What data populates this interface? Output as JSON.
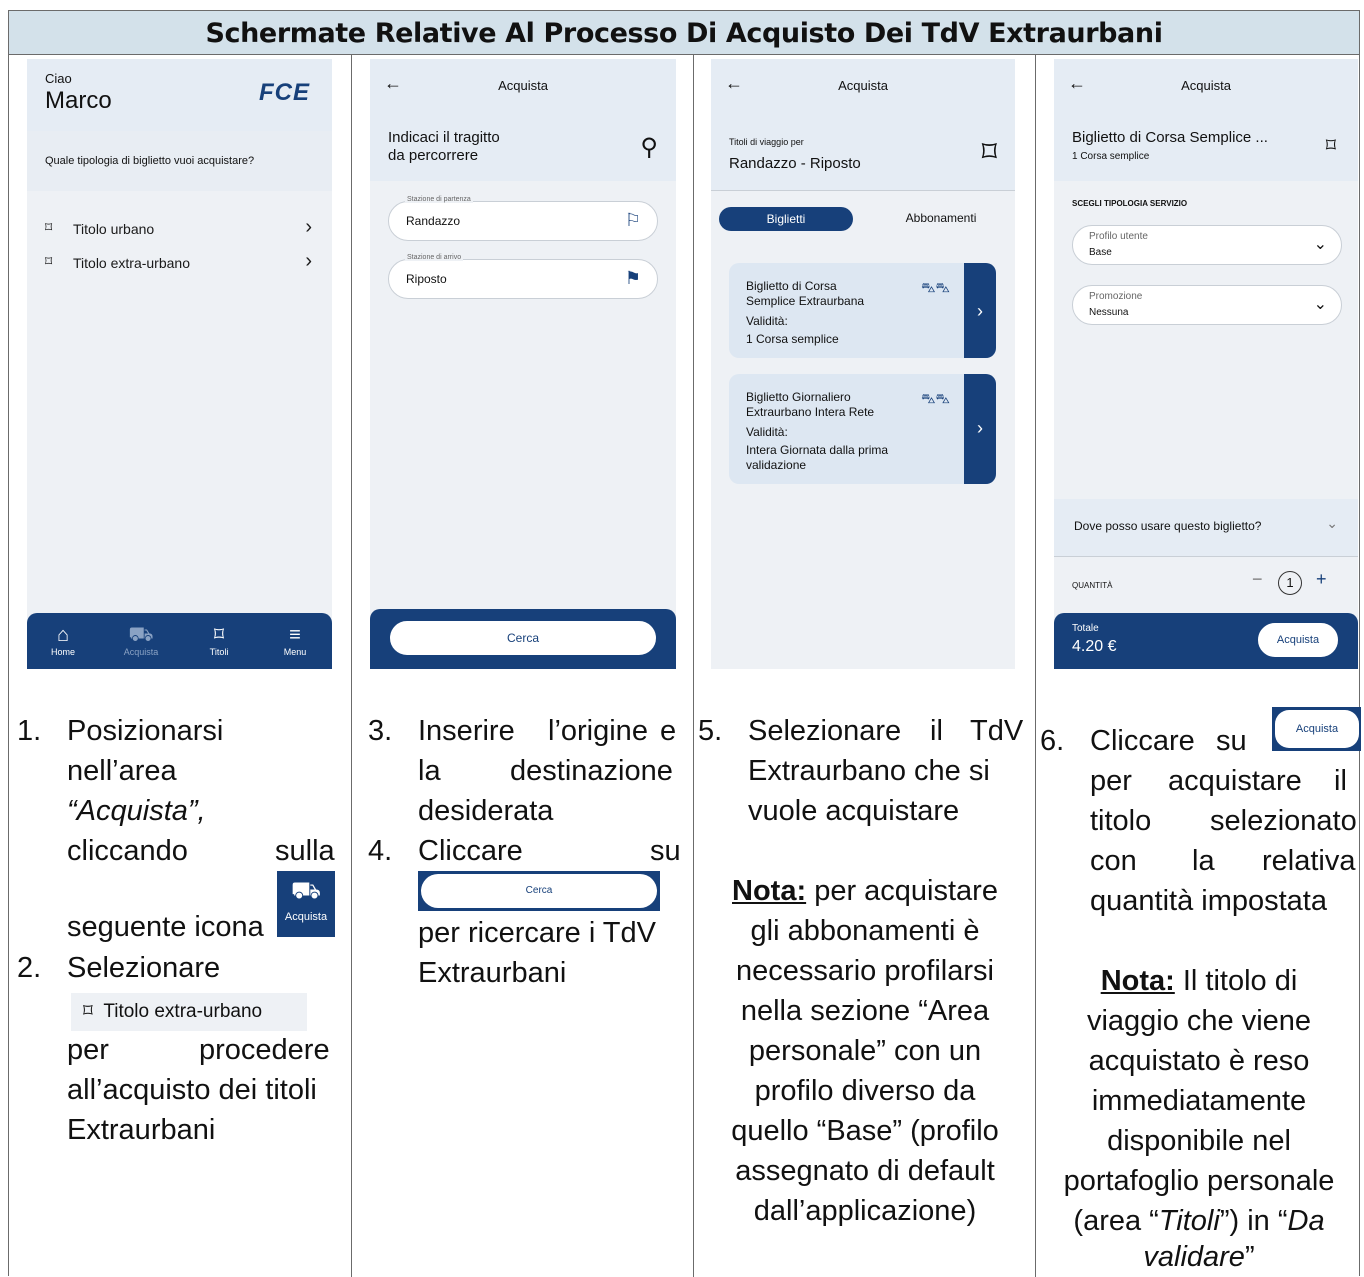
{
  "header": {
    "title": "Schermate Relative Al Processo Di Acquisto Dei TdV Extraurbani"
  },
  "screen1": {
    "greeting": "Ciao",
    "name": "Marco",
    "logo": "FCE",
    "question": "Quale tipologia di biglietto vuoi acquistare?",
    "items": [
      {
        "label": "Titolo urbano"
      },
      {
        "label": "Titolo extra-urbano"
      }
    ],
    "nav": [
      {
        "label": "Home"
      },
      {
        "label": "Acquista"
      },
      {
        "label": "Titoli"
      },
      {
        "label": "Menu"
      }
    ]
  },
  "screen2": {
    "title": "Acquista",
    "prompt_line1": "Indicaci il tragitto",
    "prompt_line2": "da percorrere",
    "dep_label": "Stazione di partenza",
    "dep_value": "Randazzo",
    "arr_label": "Stazione di arrivo",
    "arr_value": "Riposto",
    "search_button": "Cerca"
  },
  "screen3": {
    "title": "Acquista",
    "subtitle": "Titoli di viaggio per",
    "route": "Randazzo - Riposto",
    "tab_active": "Biglietti",
    "tab_inactive": "Abbonamenti",
    "cards": [
      {
        "title_l1": "Biglietto di Corsa",
        "title_l2": "Semplice Extraurbana",
        "validity_label": "Validità:",
        "validity_l1": "1 Corsa semplice",
        "validity_l2": ""
      },
      {
        "title_l1": "Biglietto Giornaliero",
        "title_l2": "Extraurbano Intera Rete",
        "validity_label": "Validità:",
        "validity_l1": "Intera Giornata dalla prima",
        "validity_l2": "validazione"
      }
    ]
  },
  "screen4": {
    "title": "Acquista",
    "ticket_title": "Biglietto di Corsa Semplice ...",
    "ticket_sub": "1 Corsa semplice",
    "section": "SCEGLI TIPOLOGIA SERVIZIO",
    "profile_label": "Profilo utente",
    "profile_value": "Base",
    "promo_label": "Promozione",
    "promo_value": "Nessuna",
    "faq": "Dove posso usare questo biglietto?",
    "qty_label": "QUANTITÀ",
    "qty_value": "1",
    "total_label": "Totale",
    "total_value": "4.20 €",
    "buy_button": "Acquista"
  },
  "instructions": {
    "s1_num": "1.",
    "s1_l1": "Posizionarsi",
    "s1_l2": "nell’area",
    "s1_l3": "“Acquista”,",
    "s1_l4a": "cliccando",
    "s1_l4b": "sulla",
    "s1_l5": "seguente icona",
    "s1_icon_label": "Acquista",
    "s2_num": "2.",
    "s2_l1": "Selezionare",
    "s2_chip": "Titolo extra-urbano",
    "s2_l2a": "per",
    "s2_l2b": "procedere",
    "s2_l3": "all’acquisto dei titoli",
    "s2_l4": "Extraurbani",
    "s3_num": "3.",
    "s3_l1a": "Inserire",
    "s3_l1b": "l’origine",
    "s3_l1c": "e",
    "s3_l2a": "la",
    "s3_l2b": "destinazione",
    "s3_l3": "desiderata",
    "s4_num": "4.",
    "s4_l1a": "Cliccare",
    "s4_l1b": "su",
    "s4_btn": "Cerca",
    "s4_l2": "per ricercare i TdV",
    "s4_l3": "Extraurbani",
    "s5_num": "5.",
    "s5_l1a": "Selezionare",
    "s5_l1b": "il",
    "s5_l1c": "TdV",
    "s5_l2": "Extraurbano che si",
    "s5_l3": "vuole acquistare",
    "n5_label": "Nota:",
    "n5_l1": "per acquistare",
    "n5_l2": "gli abbonamenti è",
    "n5_l3": "necessario profilarsi",
    "n5_l4": "nella sezione “Area",
    "n5_l5": "personale” con un",
    "n5_l6": "profilo diverso da",
    "n5_l7": "quello “Base” (profilo",
    "n5_l8": "assegnato di default",
    "n5_l9": "dall’applicazione)",
    "s6_num": "6.",
    "s6_l1a": "Cliccare",
    "s6_l1b": "su",
    "s6_btn": "Acquista",
    "s6_l2a": "per",
    "s6_l2b": "acquistare",
    "s6_l2c": "il",
    "s6_l3a": "titolo",
    "s6_l3b": "selezionato",
    "s6_l4a": "con",
    "s6_l4b": "la",
    "s6_l4c": "relativa",
    "s6_l5": "quantità impostata",
    "n6_label": "Nota:",
    "n6_l1": "Il titolo di",
    "n6_l2": "viaggio che viene",
    "n6_l3": "acquistato è reso",
    "n6_l4": "immediatamente",
    "n6_l5": "disponibile nel",
    "n6_l6": "portafoglio personale",
    "n6_l7a": "(area “",
    "n6_l7b": "Titoli",
    "n6_l7c": "”) in “",
    "n6_l7d": "Da",
    "n6_l8": "validare",
    "n6_l8b": "”"
  },
  "colors": {
    "navy": "#17407a",
    "header_band": "#d3e1ea",
    "screen_bg": "#eef1f5",
    "card_bg": "#dde7f2"
  }
}
